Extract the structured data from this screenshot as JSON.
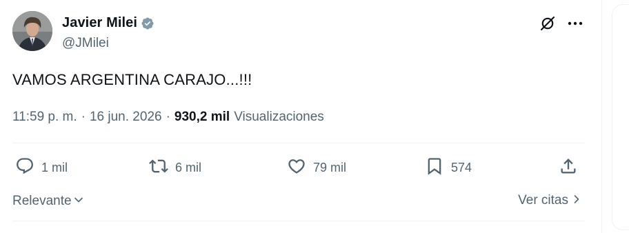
{
  "author": {
    "display_name": "Javier Milei",
    "handle": "@JMilei",
    "verified": true,
    "avatar_icon": "avatar-photo"
  },
  "tweet": {
    "text": "VAMOS ARGENTINA CARAJO...!!!",
    "time": "11:59 p. m.",
    "separator": "·",
    "date": "16 jun. 2026",
    "views_count": "930,2 mil",
    "views_label": "Visualizaciones"
  },
  "actions": {
    "replies": "1 mil",
    "retweets": "6 mil",
    "likes": "79 mil",
    "bookmarks": "574"
  },
  "footer": {
    "sort_label": "Relevante",
    "quotes_label": "Ver citas"
  },
  "colors": {
    "text": "#0f1419",
    "secondary": "#536471",
    "verified": "#829aab",
    "divider": "#eff3f4"
  }
}
